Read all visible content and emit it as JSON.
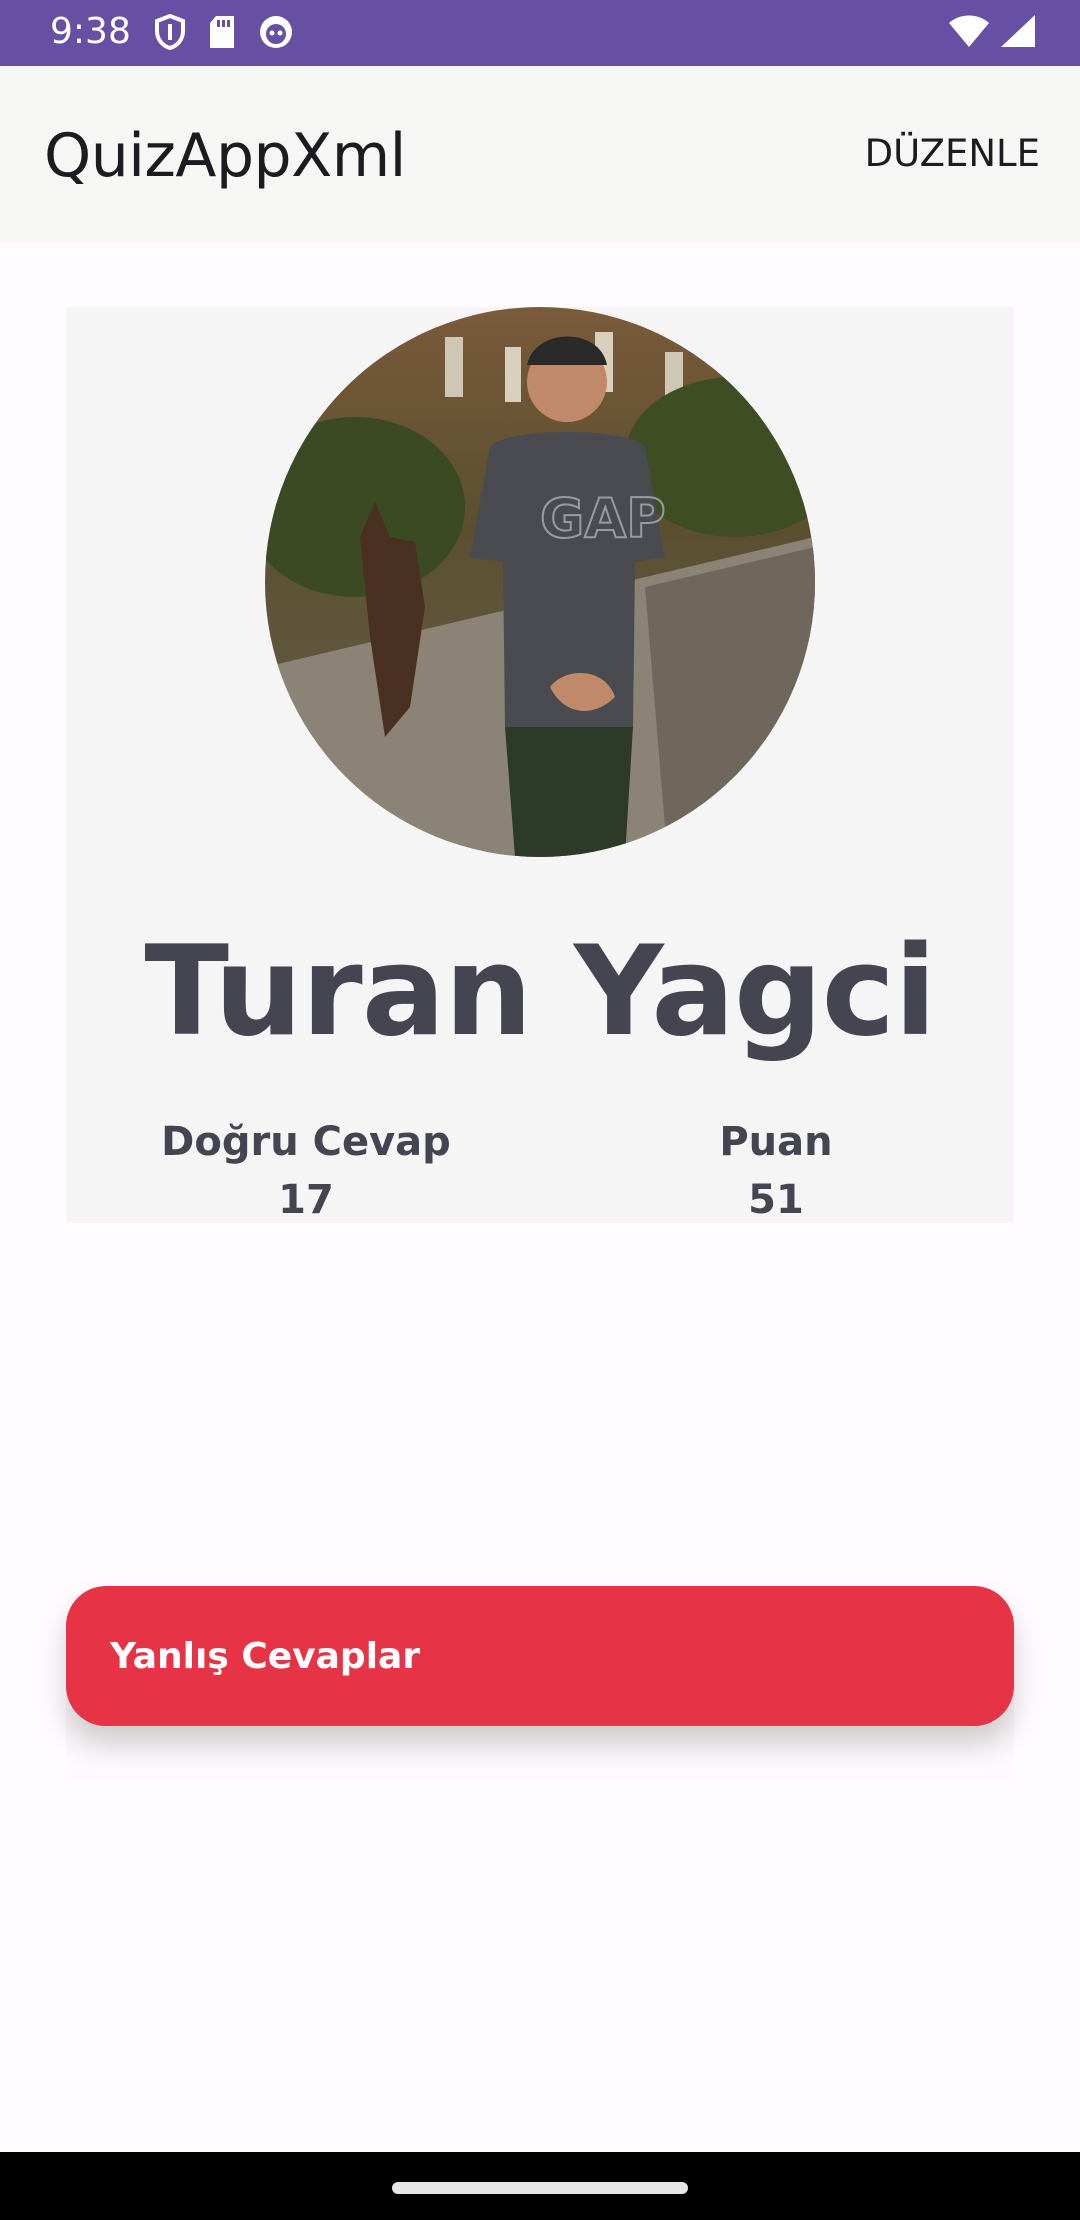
{
  "status_bar": {
    "time": "9:38",
    "left_icons": [
      "shield-icon",
      "sd-card-icon",
      "cat-face-icon"
    ],
    "right_icons": [
      "wifi-icon",
      "signal-icon"
    ],
    "color": "#6750a4"
  },
  "app_bar": {
    "title": "QuizAppXml",
    "edit_label": "DÜZENLE"
  },
  "profile": {
    "avatar_icon": "profile-photo",
    "name": "Turan Yagci",
    "correct_label": "Doğru Cevap",
    "correct_value": "17",
    "score_label": "Puan",
    "score_value": "51"
  },
  "wrong_answers": {
    "label": "Yanlış Cevaplar",
    "color": "#e63446"
  }
}
